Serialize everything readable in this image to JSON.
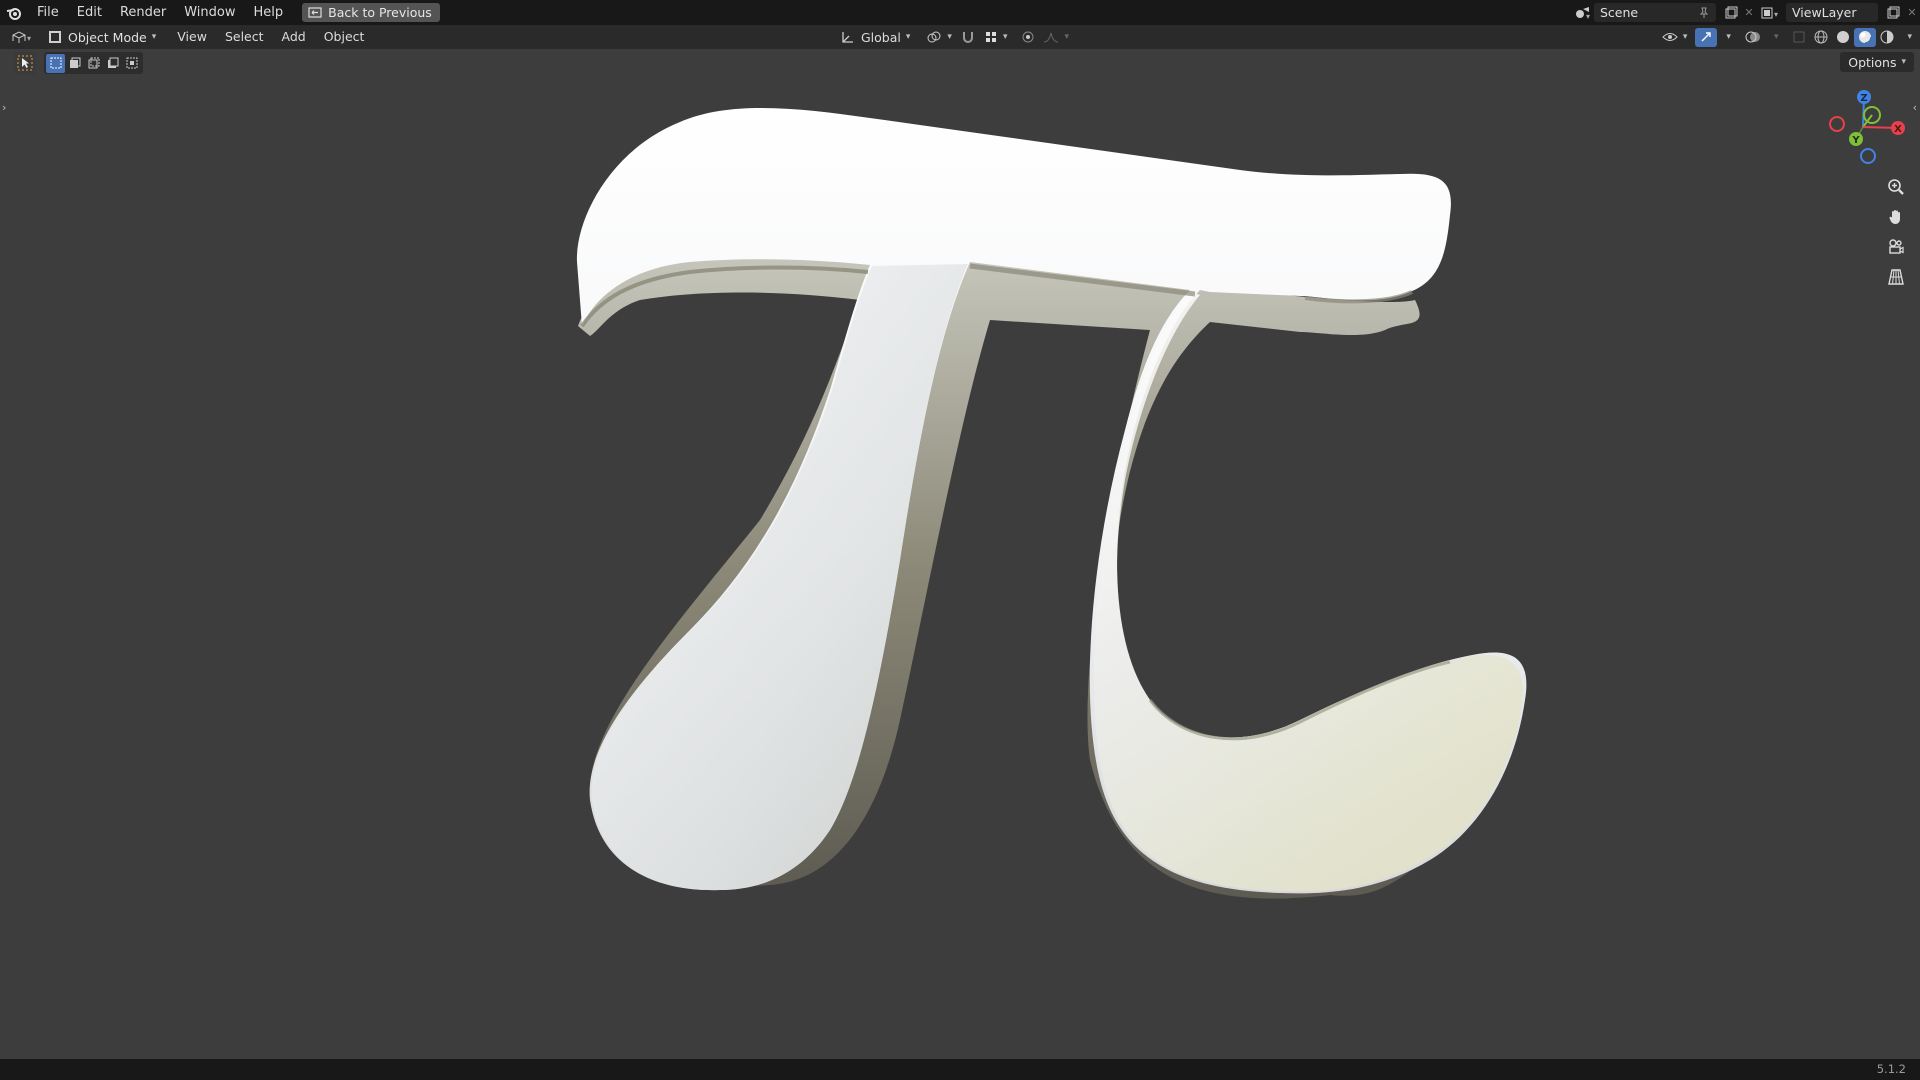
{
  "topbar": {
    "menus": [
      "File",
      "Edit",
      "Render",
      "Window",
      "Help"
    ],
    "back_button": "Back to Previous",
    "scene": "Scene",
    "view_layer": "ViewLayer"
  },
  "header": {
    "mode": "Object Mode",
    "menus": [
      "View",
      "Select",
      "Add",
      "Object"
    ],
    "transform_orientation": "Global"
  },
  "viewport": {
    "options_label": "Options",
    "object": "π",
    "gizmo_axes": [
      "Z",
      "Y",
      "X"
    ]
  },
  "status": {
    "version": "5.1.2"
  },
  "colors": {
    "axis_x": "#e8414b",
    "axis_y": "#7fbf3a",
    "axis_z": "#3f83e6",
    "active_tool": "#e2a23a",
    "highlight": "#4772b3"
  }
}
